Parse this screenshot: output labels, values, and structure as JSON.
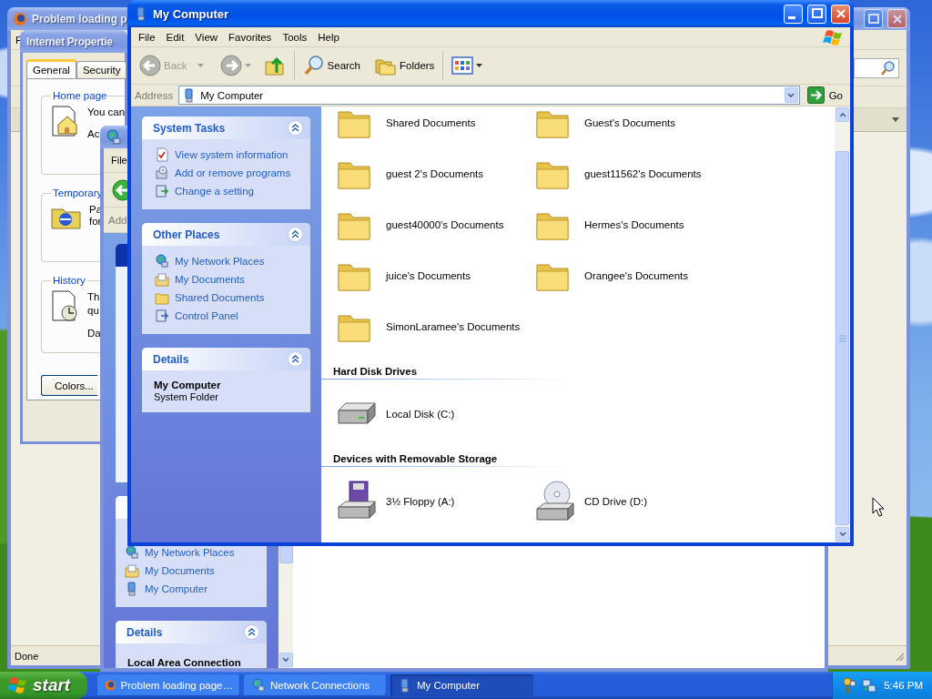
{
  "browser_window": {
    "title": "Problem loading p",
    "menu": [
      "F"
    ],
    "status": "Done"
  },
  "dialog": {
    "title": "Internet Propertie",
    "tabs": [
      {
        "label": "General",
        "selected": true
      },
      {
        "label": "Security",
        "selected": false
      }
    ],
    "groups": [
      {
        "label": "Home page",
        "kind": "home",
        "lines": [
          "You can",
          "Ac"
        ]
      },
      {
        "label": "Temporary",
        "kind": "temp",
        "lines": [
          "Pa",
          "for"
        ]
      },
      {
        "label": "History",
        "kind": "history",
        "lines": [
          "Th",
          "qu",
          "Da"
        ]
      }
    ],
    "button": "Colors..."
  },
  "network_window": {
    "menu": [
      "File"
    ],
    "address_label": "Add",
    "places": [
      {
        "label": "My Network Places",
        "kind": "network"
      },
      {
        "label": "My Documents",
        "kind": "documents"
      },
      {
        "label": "My Computer",
        "kind": "computer"
      }
    ],
    "details": {
      "title": "Details",
      "name": "Local Area Connection"
    }
  },
  "explorer_window": {
    "title": "My Computer",
    "menu": [
      "File",
      "Edit",
      "View",
      "Favorites",
      "Tools",
      "Help"
    ],
    "toolbar": [
      {
        "kind": "back",
        "label": "Back",
        "disabled": true
      },
      {
        "kind": "forward",
        "disabled": true
      },
      {
        "kind": "up"
      },
      {
        "kind": "search",
        "label": "Search"
      },
      {
        "kind": "folders",
        "label": "Folders"
      },
      {
        "kind": "views"
      }
    ],
    "address": {
      "label": "Address",
      "value": "My Computer",
      "go": "Go"
    },
    "task_panels": [
      {
        "title": "System Tasks",
        "items": [
          {
            "label": "View system information",
            "kind": "info"
          },
          {
            "label": "Add or remove programs",
            "kind": "programs"
          },
          {
            "label": "Change a setting",
            "kind": "setting"
          }
        ]
      },
      {
        "title": "Other Places",
        "items": [
          {
            "label": "My Network Places",
            "kind": "network"
          },
          {
            "label": "My Documents",
            "kind": "documents"
          },
          {
            "label": "Shared Documents",
            "kind": "folder"
          },
          {
            "label": "Control Panel",
            "kind": "control"
          }
        ]
      },
      {
        "title": "Details",
        "name": "My Computer",
        "description": "System Folder"
      }
    ],
    "groups": [
      {
        "items": [
          {
            "name": "Shared Documents",
            "kind": "folder"
          },
          {
            "name": "Guest's Documents",
            "kind": "folder"
          },
          {
            "name": "guest 2's Documents",
            "kind": "folder"
          },
          {
            "name": "guest11562's Documents",
            "kind": "folder"
          },
          {
            "name": "guest40000's Documents",
            "kind": "folder"
          },
          {
            "name": "Hermes's Documents",
            "kind": "folder"
          },
          {
            "name": "juice's Documents",
            "kind": "folder"
          },
          {
            "name": "Orangee's Documents",
            "kind": "folder"
          },
          {
            "name": "SimonLaramee's Documents",
            "kind": "folder"
          }
        ]
      },
      {
        "title": "Hard Disk Drives",
        "items": [
          {
            "name": "Local Disk (C:)",
            "kind": "disk"
          }
        ]
      },
      {
        "title": "Devices with Removable Storage",
        "items": [
          {
            "name": "3½ Floppy (A:)",
            "kind": "floppy"
          },
          {
            "name": "CD Drive (D:)",
            "kind": "cd"
          }
        ]
      }
    ]
  },
  "taskbar": {
    "start": "start",
    "tasks": [
      {
        "label": "Problem loading page…",
        "kind": "browser",
        "selected": false
      },
      {
        "label": "Network Connections",
        "kind": "network",
        "selected": false
      },
      {
        "label": "My Computer",
        "kind": "computer",
        "selected": true
      }
    ],
    "clock": "5:46 PM"
  }
}
